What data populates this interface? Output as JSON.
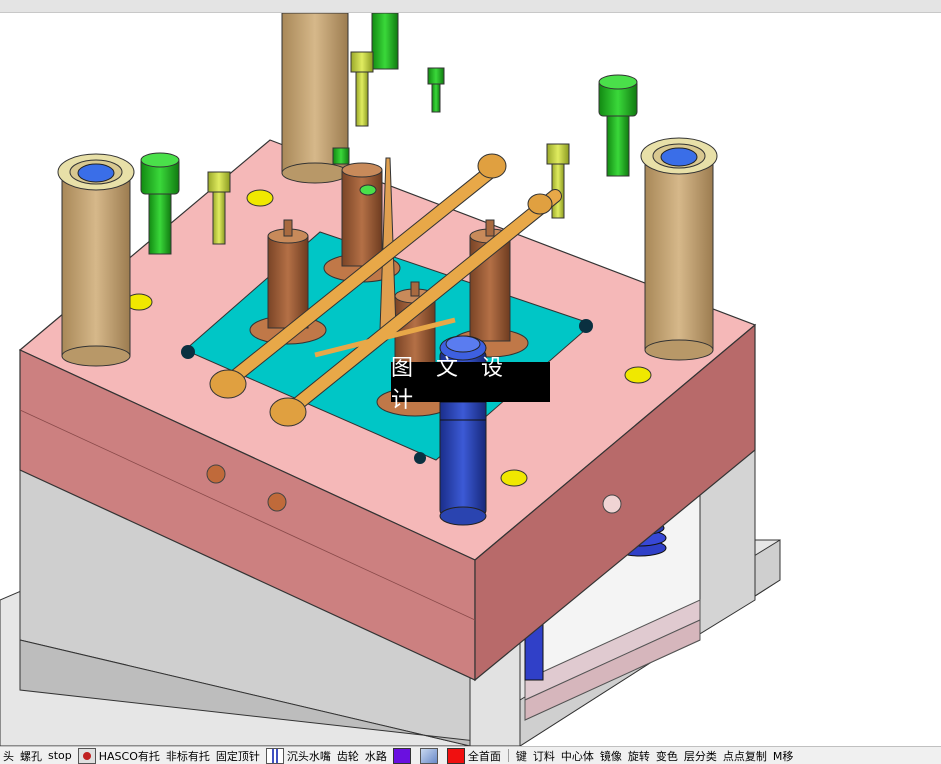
{
  "watermark": {
    "text": "图 文 设 计"
  },
  "toolbar": {
    "items": [
      {
        "label": "头",
        "icon": "none"
      },
      {
        "label": "螺孔",
        "icon": "none"
      },
      {
        "label": "stop",
        "icon": "none"
      },
      {
        "label": "HASCO有托",
        "icon": "hasco-icon"
      },
      {
        "label": "非标有托",
        "icon": "none"
      },
      {
        "label": "固定顶针",
        "icon": "none"
      },
      {
        "label": "沉头水嘴",
        "icon": "water-nozzle-icon"
      },
      {
        "label": "齿轮",
        "icon": "none"
      },
      {
        "label": "水路",
        "icon": "none"
      },
      {
        "label": "",
        "icon": "purple-color-icon"
      },
      {
        "label": "",
        "icon": "cube-view-icon"
      },
      {
        "label": "全首面",
        "icon": "red-color-icon"
      },
      {
        "label": "键",
        "icon": "none"
      },
      {
        "label": "订料",
        "icon": "none"
      },
      {
        "label": "中心体",
        "icon": "none"
      },
      {
        "label": "镜像",
        "icon": "none"
      },
      {
        "label": "旋转",
        "icon": "none"
      },
      {
        "label": "变色",
        "icon": "none"
      },
      {
        "label": "层分类",
        "icon": "none"
      },
      {
        "label": "点点复制",
        "icon": "none"
      },
      {
        "label": "M移",
        "icon": "none"
      }
    ]
  },
  "colors": {
    "plate_pink": "#f2b4b4",
    "plate_side": "#c87878",
    "plate_front": "#a86060",
    "base_grey": "#d8d8d8",
    "cavity_cyan": "#00c8c8",
    "pillar_tan": "#c8a878",
    "screw_green": "#22bb22",
    "screw_yellow": "#c8d640",
    "core_brown": "#a0603a",
    "runner_orange": "#e8a040",
    "blue": "#2a48c0",
    "hole_yellow": "#f0e000"
  }
}
